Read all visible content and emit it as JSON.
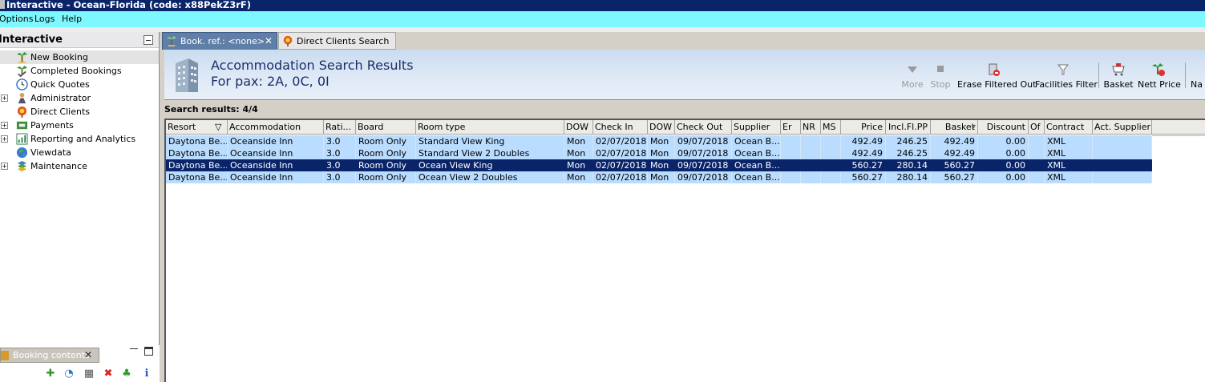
{
  "window": {
    "title": "Interactive - Ocean-Florida (code: x88PekZ3rF)"
  },
  "menu": {
    "items": [
      "Options",
      "Logs",
      "Help"
    ]
  },
  "sidebar": {
    "title": "Interactive",
    "items": [
      {
        "label": "New Booking",
        "icon": "palm-tree-icon",
        "expandable": false,
        "selected": true
      },
      {
        "label": "Completed Bookings",
        "icon": "palm-tree-check-icon",
        "expandable": false
      },
      {
        "label": "Quick Quotes",
        "icon": "clock-icon",
        "expandable": false
      },
      {
        "label": "Administrator",
        "icon": "admin-person-icon",
        "expandable": true
      },
      {
        "label": "Direct Clients",
        "icon": "direct-clients-icon",
        "expandable": false
      },
      {
        "label": "Payments",
        "icon": "payments-icon",
        "expandable": true
      },
      {
        "label": "Reporting and Analytics",
        "icon": "reporting-icon",
        "expandable": true
      },
      {
        "label": "Viewdata",
        "icon": "globe-icon",
        "expandable": false
      },
      {
        "label": "Maintenance",
        "icon": "maintenance-icon",
        "expandable": true
      }
    ]
  },
  "bottom_panel": {
    "tab_label": "Booking contents",
    "tools": [
      "add-icon",
      "clock-icon",
      "basket-icon",
      "delete-icon",
      "palm-tree-icon",
      "info-icon"
    ]
  },
  "tabs": [
    {
      "label": "Book. ref.: <none>",
      "active": true
    },
    {
      "label": "Direct Clients Search",
      "active": false
    }
  ],
  "header": {
    "title": "Accommodation Search Results",
    "pax": "For pax: 2A, 0C, 0I"
  },
  "toolbar": {
    "more": "More",
    "stop": "Stop",
    "erase": "Erase Filtered Out",
    "facilities": "Facilities Filter",
    "basket": "Basket",
    "nett": "Nett Price",
    "nav": "Na"
  },
  "results": {
    "label": "Search results: 4/4"
  },
  "grid": {
    "columns": [
      "Resort",
      "Accommodation",
      "Rati...",
      "Board",
      "Room type",
      "DOW",
      "Check In",
      "DOW",
      "Check Out",
      "Supplier",
      "Er",
      "NR",
      "MS",
      "Price",
      "Incl.Fl.PP",
      "Basket",
      "Discount",
      "Of",
      "Contract",
      "Act. Supplier"
    ],
    "rows": [
      [
        "Daytona Be...",
        "Oceanside Inn",
        "3.0",
        "Room Only",
        "Standard View King",
        "Mon",
        "02/07/2018",
        "Mon",
        "09/07/2018",
        "Ocean B...",
        "",
        "",
        "",
        "492.49",
        "246.25",
        "492.49",
        "0.00",
        "",
        "XML",
        ""
      ],
      [
        "Daytona Be...",
        "Oceanside Inn",
        "3.0",
        "Room Only",
        "Standard View 2 Doubles",
        "Mon",
        "02/07/2018",
        "Mon",
        "09/07/2018",
        "Ocean B...",
        "",
        "",
        "",
        "492.49",
        "246.25",
        "492.49",
        "0.00",
        "",
        "XML",
        ""
      ],
      [
        "Daytona Be...",
        "Oceanside Inn",
        "3.0",
        "Room Only",
        "Ocean View King",
        "Mon",
        "02/07/2018",
        "Mon",
        "09/07/2018",
        "Ocean B...",
        "",
        "",
        "",
        "560.27",
        "280.14",
        "560.27",
        "0.00",
        "",
        "XML",
        ""
      ],
      [
        "Daytona Be...",
        "Oceanside Inn",
        "3.0",
        "Room Only",
        "Ocean View 2 Doubles",
        "Mon",
        "02/07/2018",
        "Mon",
        "09/07/2018",
        "Ocean B...",
        "",
        "",
        "",
        "560.27",
        "280.14",
        "560.27",
        "0.00",
        "",
        "XML",
        ""
      ]
    ],
    "selected_row": 2
  },
  "colors": {
    "titlebar": "#0a246a",
    "menubar": "#7ef8ff",
    "row": "#b9dcff",
    "selected_row": "#0a246a",
    "active_tab": "#5f7ea8"
  }
}
